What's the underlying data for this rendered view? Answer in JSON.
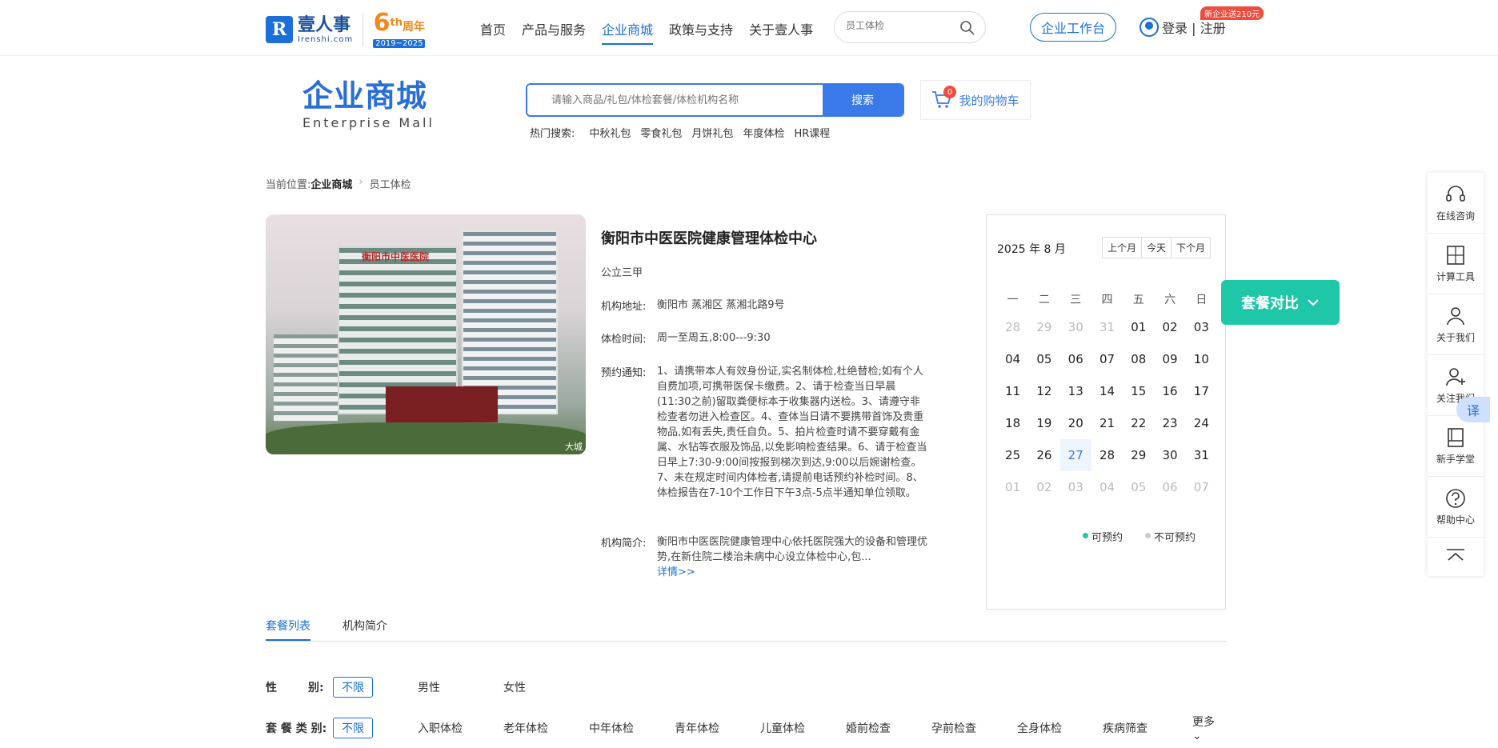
{
  "nav": {
    "logo_cn": "壹人事",
    "logo_en": "Irenshi.com",
    "anniv_num": "6",
    "anniv_sup": "th",
    "anniv_label": "周年",
    "anniv_years": "2019~2025",
    "items": [
      "首页",
      "产品与服务",
      "企业商城",
      "政策与支持",
      "关于壹人事"
    ],
    "active": "企业商城",
    "search_placeholder": "员工体检",
    "workbench": "企业工作台",
    "login": "登录 | 注册",
    "promo": "新企业送210元"
  },
  "mall": {
    "title_cn": "企业商城",
    "title_en": "Enterprise  Mall",
    "search_placeholder": "请输入商品/礼包/体检套餐/体检机构名称",
    "search_button": "搜索",
    "cart_label": "我的购物车",
    "cart_count": "0",
    "hot_label": "热门搜索:",
    "hot_items": [
      "中秋礼包",
      "零食礼包",
      "月饼礼包",
      "年度体检",
      "HR课程"
    ]
  },
  "breadcrumb": {
    "label": "当前位置:",
    "items": [
      "企业商城",
      "员工体检"
    ]
  },
  "hospital": {
    "name": "衡阳市中医医院健康管理体检中心",
    "level": "公立三甲",
    "address_label": "机构地址:",
    "address": "衡阳市 蒸湘区 蒸湘北路9号",
    "time_label": "体检时间:",
    "time": "周一至周五,8:00---9:30",
    "notice_label": "预约通知:",
    "notice": "1、请携带本人有效身份证,实名制体检,杜绝替检;如有个人自费加项,可携带医保卡缴费。2、请于检查当日早晨(11:30之前)留取粪便标本于收集器内送检。3、请遵守非检查者勿进入检查区。4、查体当日请不要携带首饰及贵重物品,如有丢失,责任自负。5、拍片检查时请不要穿戴有金属、水钻等衣服及饰品,以免影响检查结果。6、请于检查当日早上7:30-9:00间按报到梯次到达,9:00以后婉谢检查。7、未在规定时间内体检者,请提前电话预约补检时间。8、体检报告在7-10个工作日下午3点-5点半通知单位领取。",
    "intro_label": "机构简介:",
    "intro": "衡阳市中医医院健康管理中心依托医院强大的设备和管理优势,在新住院二楼治未病中心设立体检中心,包...",
    "more": "详情>>",
    "photo_sign": "衡阳市中医医院",
    "photo_watermark": "大城"
  },
  "calendar": {
    "title": "2025 年 8 月",
    "prev": "上个月",
    "today": "今天",
    "next": "下个月",
    "weekdays": [
      "一",
      "二",
      "三",
      "四",
      "五",
      "六",
      "日"
    ],
    "days": [
      "28",
      "29",
      "30",
      "31",
      "01",
      "02",
      "03",
      "04",
      "05",
      "06",
      "07",
      "08",
      "09",
      "10",
      "11",
      "12",
      "13",
      "14",
      "15",
      "16",
      "17",
      "18",
      "19",
      "20",
      "21",
      "22",
      "23",
      "24",
      "25",
      "26",
      "27",
      "28",
      "29",
      "30",
      "31",
      "01",
      "02",
      "03",
      "04",
      "05",
      "06",
      "07"
    ],
    "legend_available": "可预约",
    "legend_unavailable": "不可预约",
    "available_color": "#1dc7a8",
    "unavailable_color": "#cccccc"
  },
  "compare": {
    "label": "套餐对比"
  },
  "sidebar": {
    "items": [
      "在线咨询",
      "计算工具",
      "关于我们",
      "关注我们",
      "新手学堂",
      "帮助中心"
    ],
    "translate": "译"
  },
  "tabs": [
    "套餐列表",
    "机构简介"
  ],
  "filters": {
    "gender_label": "性        别:",
    "gender_selected": "不限",
    "gender_options": [
      "男性",
      "女性"
    ],
    "category_label": "套 餐 类 别:",
    "category_selected": "不限",
    "category_options": [
      "入职体检",
      "老年体检",
      "中年体检",
      "青年体检",
      "儿童体检",
      "婚前检查",
      "孕前检查",
      "全身体检",
      "疾病筛查"
    ],
    "more": "更多"
  }
}
